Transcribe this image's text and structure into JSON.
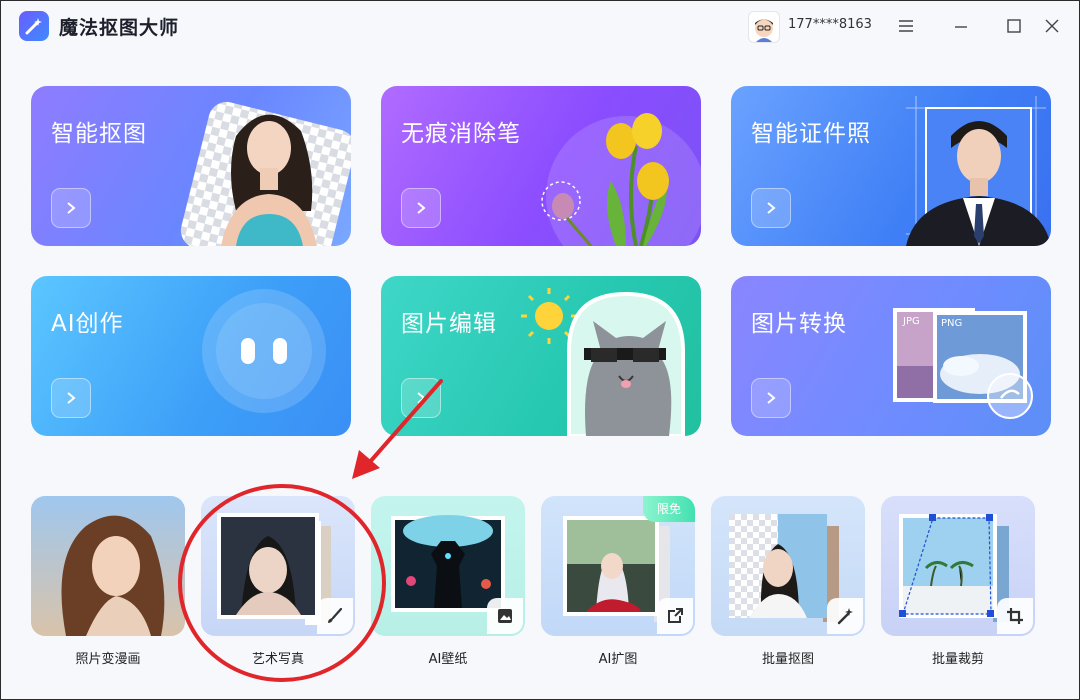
{
  "app": {
    "title": "魔法抠图大师",
    "user": "177****8163"
  },
  "cards": [
    {
      "title": "智能抠图"
    },
    {
      "title": "无痕消除笔"
    },
    {
      "title": "智能证件照"
    },
    {
      "title": "AI创作"
    },
    {
      "title": "图片编辑"
    },
    {
      "title": "图片转换",
      "tags": [
        "JPG",
        "PNG"
      ]
    }
  ],
  "tools": [
    {
      "label": "照片变漫画"
    },
    {
      "label": "艺术写真"
    },
    {
      "label": "AI壁纸"
    },
    {
      "label": "AI扩图",
      "badge": "限免"
    },
    {
      "label": "批量抠图"
    },
    {
      "label": "批量裁剪"
    }
  ],
  "colors": {
    "annotation": "#e0262a",
    "accent": "#5b6cff"
  }
}
